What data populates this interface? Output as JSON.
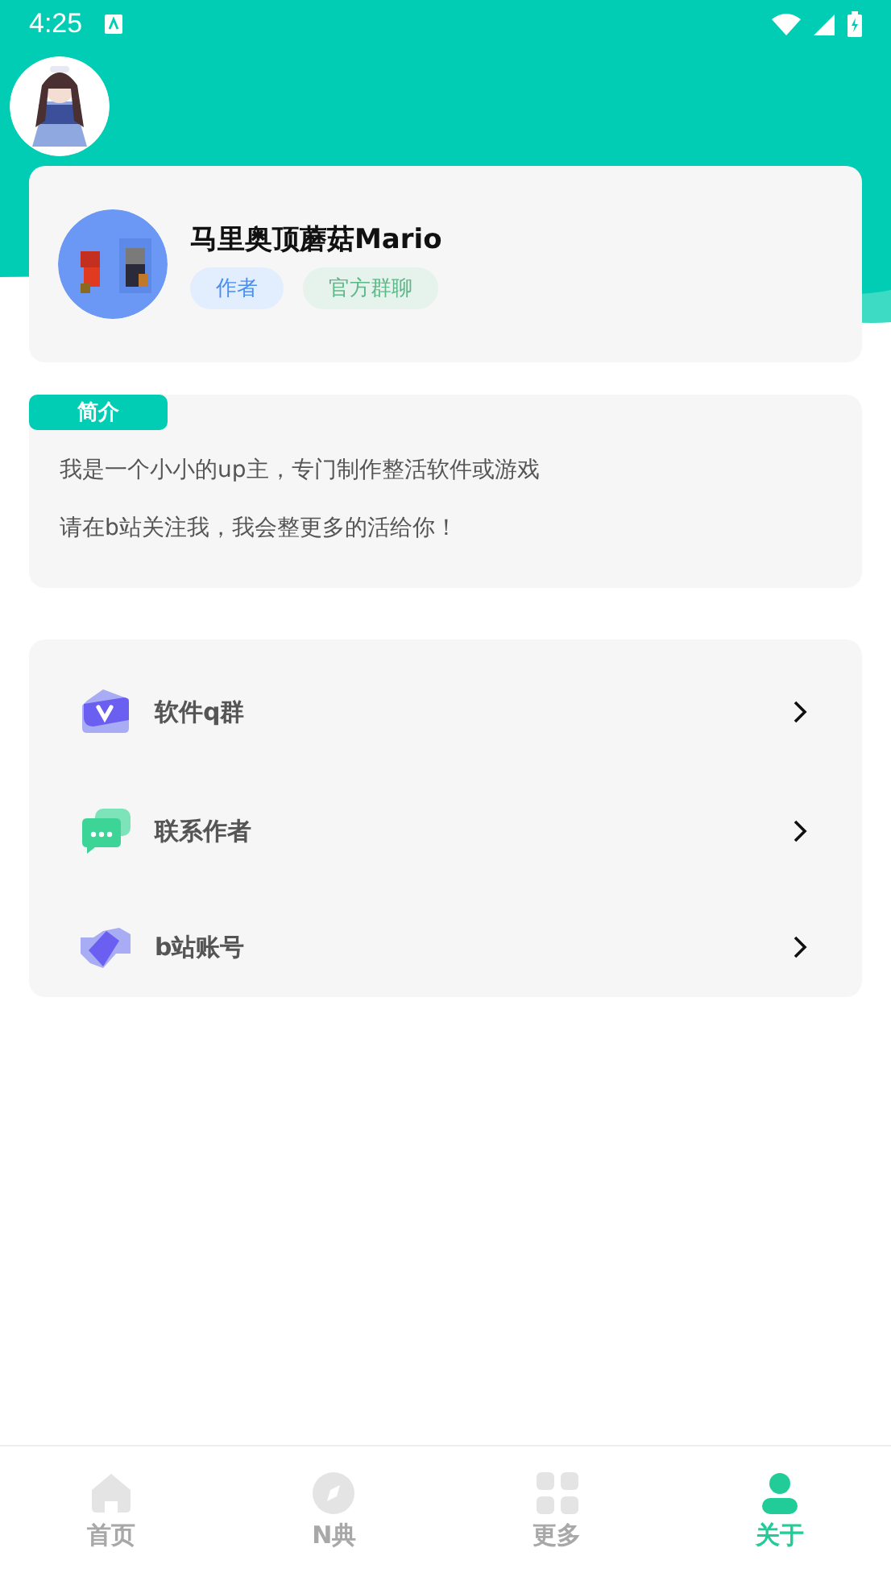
{
  "status_bar": {
    "time": "4:25"
  },
  "profile": {
    "name": "马里奥顶蘑菇Mario",
    "tags": [
      {
        "label": "作者",
        "kind": "author"
      },
      {
        "label": "官方群聊",
        "kind": "group"
      }
    ]
  },
  "intro": {
    "title": "简介",
    "lines": [
      "我是一个小小的up主，专门制作整活软件或游戏",
      "请在b站关注我，我会整更多的活给你！"
    ]
  },
  "menu": [
    {
      "label": "软件q群",
      "kind": "qq"
    },
    {
      "label": "联系作者",
      "kind": "chat"
    },
    {
      "label": "b站账号",
      "kind": "handshake"
    }
  ],
  "tabs": [
    {
      "label": "首页",
      "kind": "home",
      "selected": false
    },
    {
      "label": "N典",
      "kind": "compass",
      "selected": false
    },
    {
      "label": "更多",
      "kind": "grid",
      "selected": false
    },
    {
      "label": "关于",
      "kind": "person",
      "selected": true
    }
  ]
}
